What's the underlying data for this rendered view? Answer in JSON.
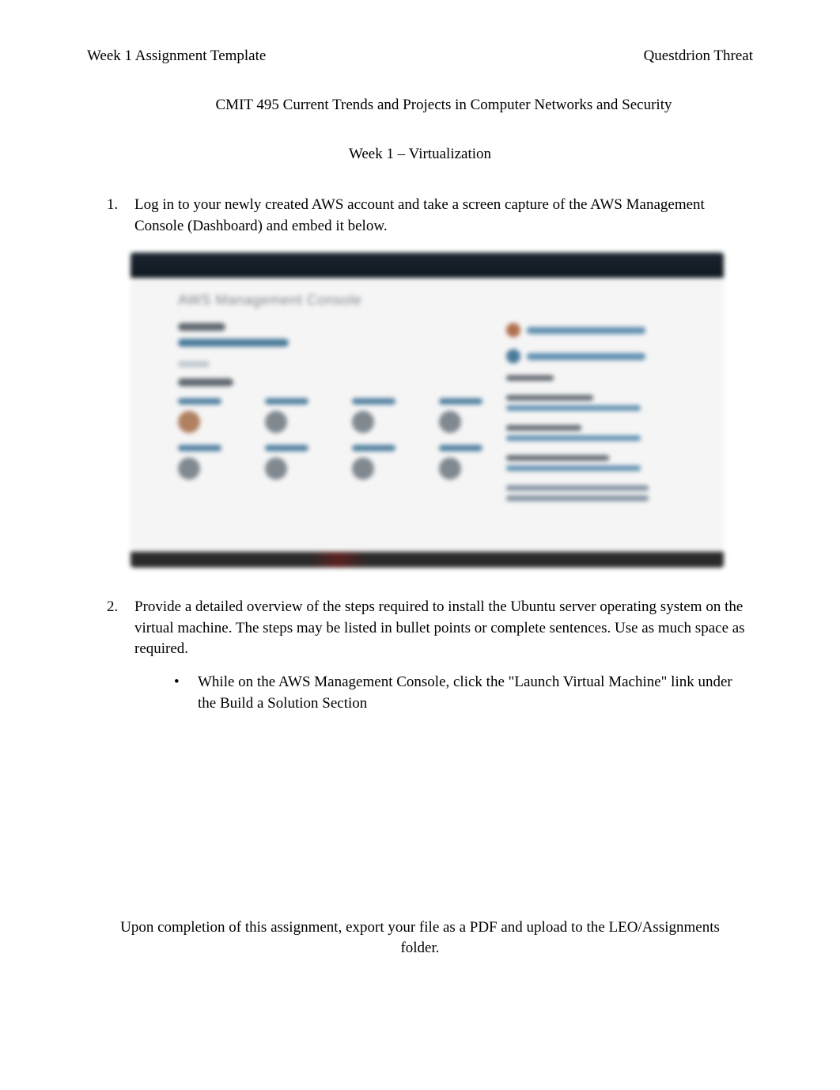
{
  "header": {
    "left": "Week 1 Assignment Template",
    "right": "Questdrion Threat"
  },
  "course_title": "CMIT 495 Current Trends and Projects in Computer Networks and Security",
  "week_title": "Week 1  – Virtualization",
  "questions": {
    "q1": {
      "number": "1.",
      "text": "Log in to your newly created AWS account and take a screen capture of the AWS Management Console (Dashboard) and embed it below."
    },
    "q2": {
      "number": "2.",
      "text": "Provide a detailed overview of the steps required to install the Ubuntu server operating system on the virtual machine. The steps may be listed in bullet points or complete sentences. Use as much space as required.",
      "bullet": "While on the AWS Management Console, click the \"Launch Virtual Machine\" link under the Build a Solution Section"
    }
  },
  "screenshot": {
    "console_title": "AWS Management Console"
  },
  "footer": "Upon completion of this assignment, export your file as a PDF and upload to the LEO/Assignments folder."
}
